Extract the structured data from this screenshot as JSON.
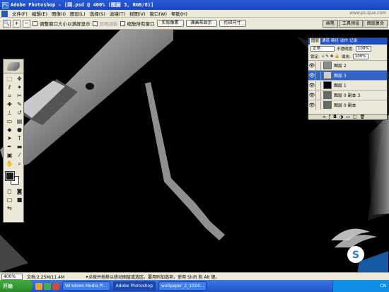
{
  "window": {
    "title": "Adobe Photoshop - [网.psd @ 400% (图层 3, RGB/8)]"
  },
  "menu": {
    "items": [
      "文件(F)",
      "编辑(E)",
      "图像(I)",
      "图层(L)",
      "选择(S)",
      "滤镜(T)",
      "视图(V)",
      "窗口(W)",
      "帮助(H)"
    ],
    "watermark_text": "www.ps.sjue.com"
  },
  "options": {
    "resize_windows_label": "调整窗口大小以满屏显示",
    "ignore_palettes_label": "忽略调板",
    "zoom_all_label": "缩放所有窗口",
    "actual_pixels": "实际像素",
    "fit_screen": "满画布显示",
    "print_size": "打印尺寸",
    "panel_tabs": [
      "画笔",
      "工具预设",
      "图层复合"
    ]
  },
  "layers_panel": {
    "tabs": [
      "图层",
      "通道",
      "路径",
      "动作",
      "记录"
    ],
    "blend_mode": "正常",
    "opacity_label": "不透明度:",
    "opacity_value": "100%",
    "lock_label": "锁定:",
    "fill_label": "填充:",
    "fill_value": "100%",
    "layers": [
      {
        "name": "图层 2",
        "selected": false,
        "thumb": "#8a8a8a"
      },
      {
        "name": "图层 3",
        "selected": true,
        "thumb": "#cfcfcf"
      },
      {
        "name": "图层 1",
        "selected": false,
        "thumb": "#000000"
      },
      {
        "name": "图层 0 副本 3",
        "selected": false,
        "thumb": "#6a6a6a"
      },
      {
        "name": "图层 0 副本",
        "selected": false,
        "thumb": "#6a6a6a"
      }
    ]
  },
  "status": {
    "zoom": "400%",
    "doc_size": "文档:2.25M/11.4M",
    "hint": "点按并拖移以移动图层或选区。要用附加选项，使用 Shift 和 Alt 键。"
  },
  "taskbar": {
    "start_label": "开始",
    "tasks": [
      "Windows Media Pl...",
      "Adobe Photoshop",
      "wallpaper_2_1024..."
    ],
    "tray_text": "CN"
  },
  "colors": {
    "titlebar": "#1846c4",
    "selection": "#3264c8",
    "chrome": "#ece9d8"
  }
}
